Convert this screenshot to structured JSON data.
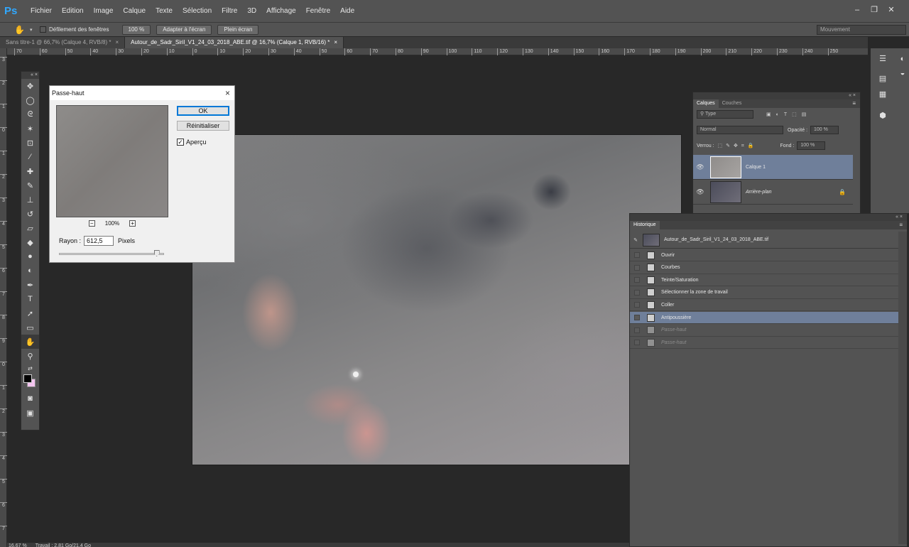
{
  "app": {
    "logo": "Ps"
  },
  "menu": [
    "Fichier",
    "Edition",
    "Image",
    "Calque",
    "Texte",
    "Sélection",
    "Filtre",
    "3D",
    "Affichage",
    "Fenêtre",
    "Aide"
  ],
  "options": {
    "scroll_all_label": "Défilement des fenêtres",
    "zoom_btn": "100 %",
    "fit_btn": "Adapter à l'écran",
    "fullscreen_btn": "Plein écran",
    "workspace": "Mouvement"
  },
  "tabs": [
    {
      "label": "Sans titre-1 @ 66,7% (Calque 4, RVB/8) *",
      "close": "×"
    },
    {
      "label": "Autour_de_Sadr_Siril_V1_24_03_2018_ABE.tif @ 16,7% (Calque 1, RVB/16) *",
      "close": "×"
    }
  ],
  "ruler_h": [
    "70",
    "60",
    "50",
    "40",
    "30",
    "20",
    "10",
    "0",
    "10",
    "20",
    "30",
    "40",
    "50",
    "60",
    "70",
    "80",
    "90",
    "100",
    "110",
    "120",
    "130",
    "140",
    "150",
    "160",
    "170",
    "180",
    "190",
    "200",
    "210",
    "220",
    "230",
    "240",
    "250"
  ],
  "ruler_v": [
    "3",
    "2",
    "1",
    "0",
    "1",
    "2",
    "3",
    "4",
    "5",
    "6",
    "7",
    "8",
    "9",
    "0",
    "1",
    "2",
    "3",
    "4",
    "5",
    "6",
    "7"
  ],
  "dialog": {
    "title": "Passe-haut",
    "close": "×",
    "ok": "OK",
    "reset": "Réinitialiser",
    "preview_label": "Aperçu",
    "zoom": "100%",
    "zoom_out": "−",
    "zoom_in": "+",
    "radius_label": "Rayon :",
    "radius_value": "612,5",
    "radius_unit": "Pixels",
    "radius_slider_fraction": 0.93
  },
  "layers_panel": {
    "tabs": [
      "Calques",
      "Couches"
    ],
    "filter": "Type",
    "blend_mode": "Normal",
    "opacity_label": "Opacité :",
    "opacity_value": "100 %",
    "lock_label": "Verrou :",
    "fill_label": "Fond :",
    "fill_value": "100 %",
    "layers": [
      {
        "name": "Calque 1",
        "selected": true
      },
      {
        "name": "Arrière-plan",
        "selected": false
      }
    ]
  },
  "history_panel": {
    "title": "Historique",
    "snapshot": "Autour_de_Sadr_Siril_V1_24_03_2018_ABE.tif",
    "items": [
      {
        "label": "Ouvrir",
        "state": "normal"
      },
      {
        "label": "Courbes",
        "state": "normal"
      },
      {
        "label": "Teinte/Saturation",
        "state": "normal"
      },
      {
        "label": "Sélectionner la zone de travail",
        "state": "normal"
      },
      {
        "label": "Coller",
        "state": "normal"
      },
      {
        "label": "Antipoussière",
        "state": "selected"
      },
      {
        "label": "Passe-haut",
        "state": "undone"
      },
      {
        "label": "Passe-haut",
        "state": "undone"
      }
    ]
  },
  "status": {
    "zoom": "16,67 %",
    "info": "Travail : 2,81 Go/21,4 Go"
  },
  "colors": {
    "accent": "#31a8ff",
    "selection": "#6f7f9a",
    "panel": "#535353",
    "background": "#282828"
  }
}
